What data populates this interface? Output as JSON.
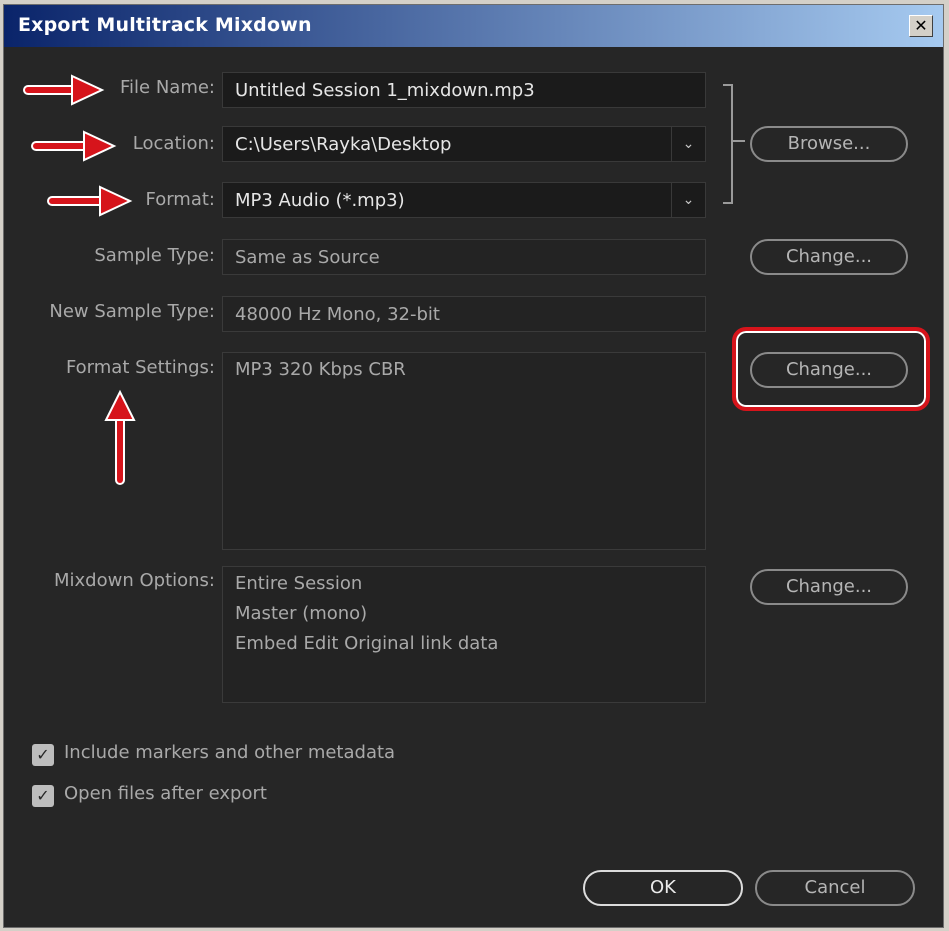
{
  "window": {
    "title": "Export Multitrack Mixdown",
    "close_glyph": "✕"
  },
  "fields": {
    "file_name": {
      "label": "File Name:",
      "value": "Untitled Session 1_mixdown.mp3"
    },
    "location": {
      "label": "Location:",
      "value": "C:\\Users\\Rayka\\Desktop"
    },
    "format": {
      "label": "Format:",
      "value": "MP3 Audio (*.mp3)"
    },
    "sample_type": {
      "label": "Sample Type:",
      "value": "Same as Source"
    },
    "new_sample_type": {
      "label": "New Sample Type:",
      "value": "48000 Hz Mono, 32-bit"
    },
    "format_settings": {
      "label": "Format Settings:",
      "value": "MP3 320 Kbps CBR"
    },
    "mixdown_options": {
      "label": "Mixdown Options:",
      "value": "Entire Session\nMaster (mono)\nEmbed Edit Original link data"
    }
  },
  "buttons": {
    "browse": "Browse...",
    "change_sample": "Change...",
    "change_format": "Change...",
    "change_mixdown": "Change...",
    "ok": "OK",
    "cancel": "Cancel"
  },
  "checkboxes": {
    "markers": {
      "label": "Include markers and other metadata",
      "checked": true
    },
    "open_files": {
      "label": "Open files after export",
      "checked": true
    }
  },
  "annotations": {
    "arrow_color": "#d6141b",
    "highlight_color": "#d6141b"
  }
}
